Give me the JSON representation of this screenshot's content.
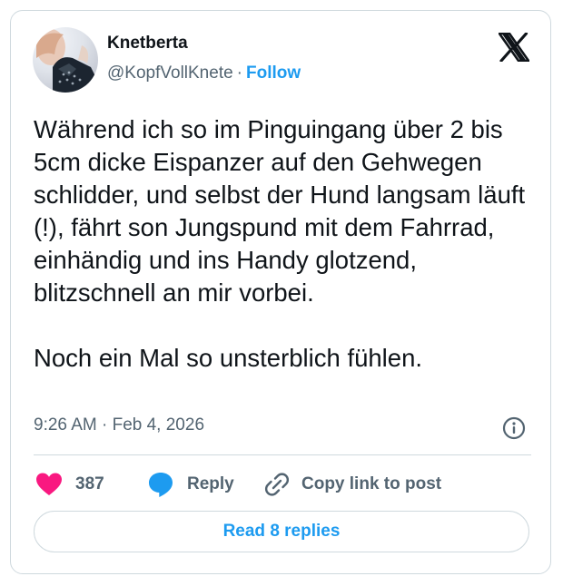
{
  "author": {
    "name": "Knetberta",
    "handle": "@KopfVollKnete",
    "separator": "·",
    "follow_label": "Follow",
    "avatar_icon": "profile-photo"
  },
  "brand": {
    "logo_icon": "x-logo-icon"
  },
  "post": {
    "paragraphs": [
      "Während ich so im Pinguingang über 2 bis 5cm dicke Eispanzer auf den Gehwegen schlidder, und selbst der Hund langsam läuft (!), fährt son Jungspund mit dem Fahrrad, einhändig und ins Handy glotzend, blitzschnell an mir vorbei.",
      "Noch ein Mal so unsterblich fühlen."
    ],
    "timestamp": "9:26 AM · Feb 4, 2026",
    "info_icon": "info-icon"
  },
  "actions": {
    "like_count": "387",
    "like_icon": "heart-icon",
    "reply_label": "Reply",
    "reply_icon": "speech-bubble-icon",
    "copy_label": "Copy link to post",
    "copy_icon": "link-icon"
  },
  "footer": {
    "read_replies_label": "Read 8 replies"
  },
  "colors": {
    "accent": "#1d9bf0",
    "like": "#f91880",
    "text": "#0f1419",
    "muted": "#536471",
    "border": "#cfd9de"
  }
}
